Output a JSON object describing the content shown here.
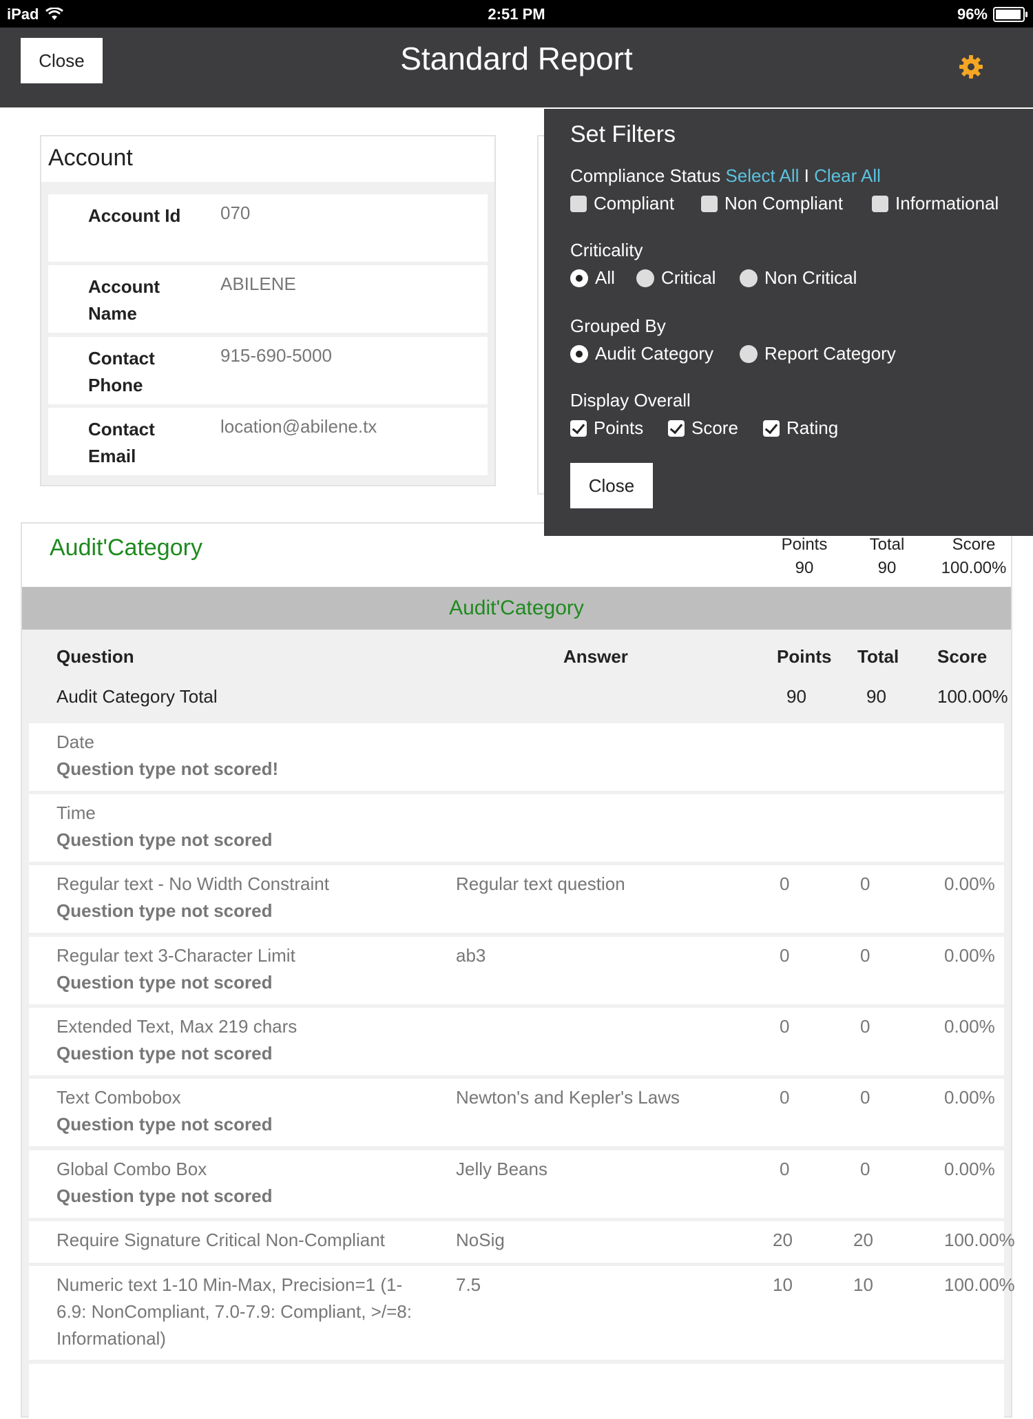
{
  "status_bar": {
    "device": "iPad",
    "time": "2:51 PM",
    "battery": "96%",
    "battery_level": 0.96
  },
  "nav": {
    "close_label": "Close",
    "title": "Standard Report",
    "settings_icon": "gear-icon",
    "accent": "#f5a623"
  },
  "account": {
    "title": "Account",
    "rows": [
      {
        "label": "Account Id",
        "value": "070"
      },
      {
        "label": "Account Name",
        "value": "ABILENE"
      },
      {
        "label": "Contact Phone",
        "value": "915-690-5000"
      },
      {
        "label": "Contact Email",
        "value": "location@abilene.tx"
      }
    ]
  },
  "filters": {
    "title": "Set Filters",
    "compliance_label": "Compliance Status",
    "select_all": "Select All",
    "separator": "I",
    "clear_all": "Clear All",
    "compliance_options": [
      "Compliant",
      "Non Compliant",
      "Informational"
    ],
    "criticality_label": "Criticality",
    "criticality_options": [
      "All",
      "Critical",
      "Non Critical"
    ],
    "criticality_selected": "All",
    "grouped_label": "Grouped By",
    "grouped_options": [
      "Audit Category",
      "Report Category"
    ],
    "grouped_selected": "Audit Category",
    "display_label": "Display Overall",
    "display_options": [
      "Points",
      "Score",
      "Rating"
    ],
    "close_label": "Close",
    "link_color": "#5bc2e0"
  },
  "audit": {
    "title": "Audit'Category",
    "stats": [
      {
        "label": "Points",
        "value": "90"
      },
      {
        "label": "Total",
        "value": "90"
      },
      {
        "label": "Score",
        "value": "100.00%"
      }
    ],
    "band": "Audit'Category",
    "columns": {
      "question": "Question",
      "answer": "Answer",
      "points": "Points",
      "total": "Total",
      "score": "Score"
    },
    "total_row": {
      "label": "Audit Category Total",
      "points": "90",
      "total": "90",
      "score": "100.00%"
    },
    "rows": [
      {
        "question": "Date",
        "note": "Question type not scored!",
        "answer": "",
        "points": "",
        "total": "",
        "score": ""
      },
      {
        "question": "Time",
        "note": "Question type not scored",
        "answer": "",
        "points": "",
        "total": "",
        "score": ""
      },
      {
        "question": "Regular text - No Width Constraint",
        "note": "Question type not scored",
        "answer": "Regular text question",
        "points": "0",
        "total": "0",
        "score": "0.00%"
      },
      {
        "question": "Regular text 3-Character Limit",
        "note": "Question type not scored",
        "answer": "ab3",
        "points": "0",
        "total": "0",
        "score": "0.00%"
      },
      {
        "question": "Extended Text, Max 219 chars",
        "note": "Question type not scored",
        "answer": "",
        "points": "0",
        "total": "0",
        "score": "0.00%"
      },
      {
        "question": "Text Combobox",
        "note": "Question type not scored",
        "answer": "Newton's and Kepler's Laws",
        "points": "0",
        "total": "0",
        "score": "0.00%"
      },
      {
        "question": "Global Combo Box",
        "note": "Question type not scored",
        "answer": "Jelly Beans",
        "points": "0",
        "total": "0",
        "score": "0.00%"
      },
      {
        "question": "Require Signature Critical Non-Compliant",
        "note": "",
        "answer": "NoSig",
        "points": "20",
        "total": "20",
        "score": "100.00%"
      },
      {
        "question": "Numeric text 1-10 Min-Max, Precision=1 (1-6.9: NonCompliant, 7.0-7.9: Compliant, >/=8: Informational)",
        "note": "",
        "answer": "7.5",
        "points": "10",
        "total": "10",
        "score": "100.00%"
      }
    ]
  }
}
